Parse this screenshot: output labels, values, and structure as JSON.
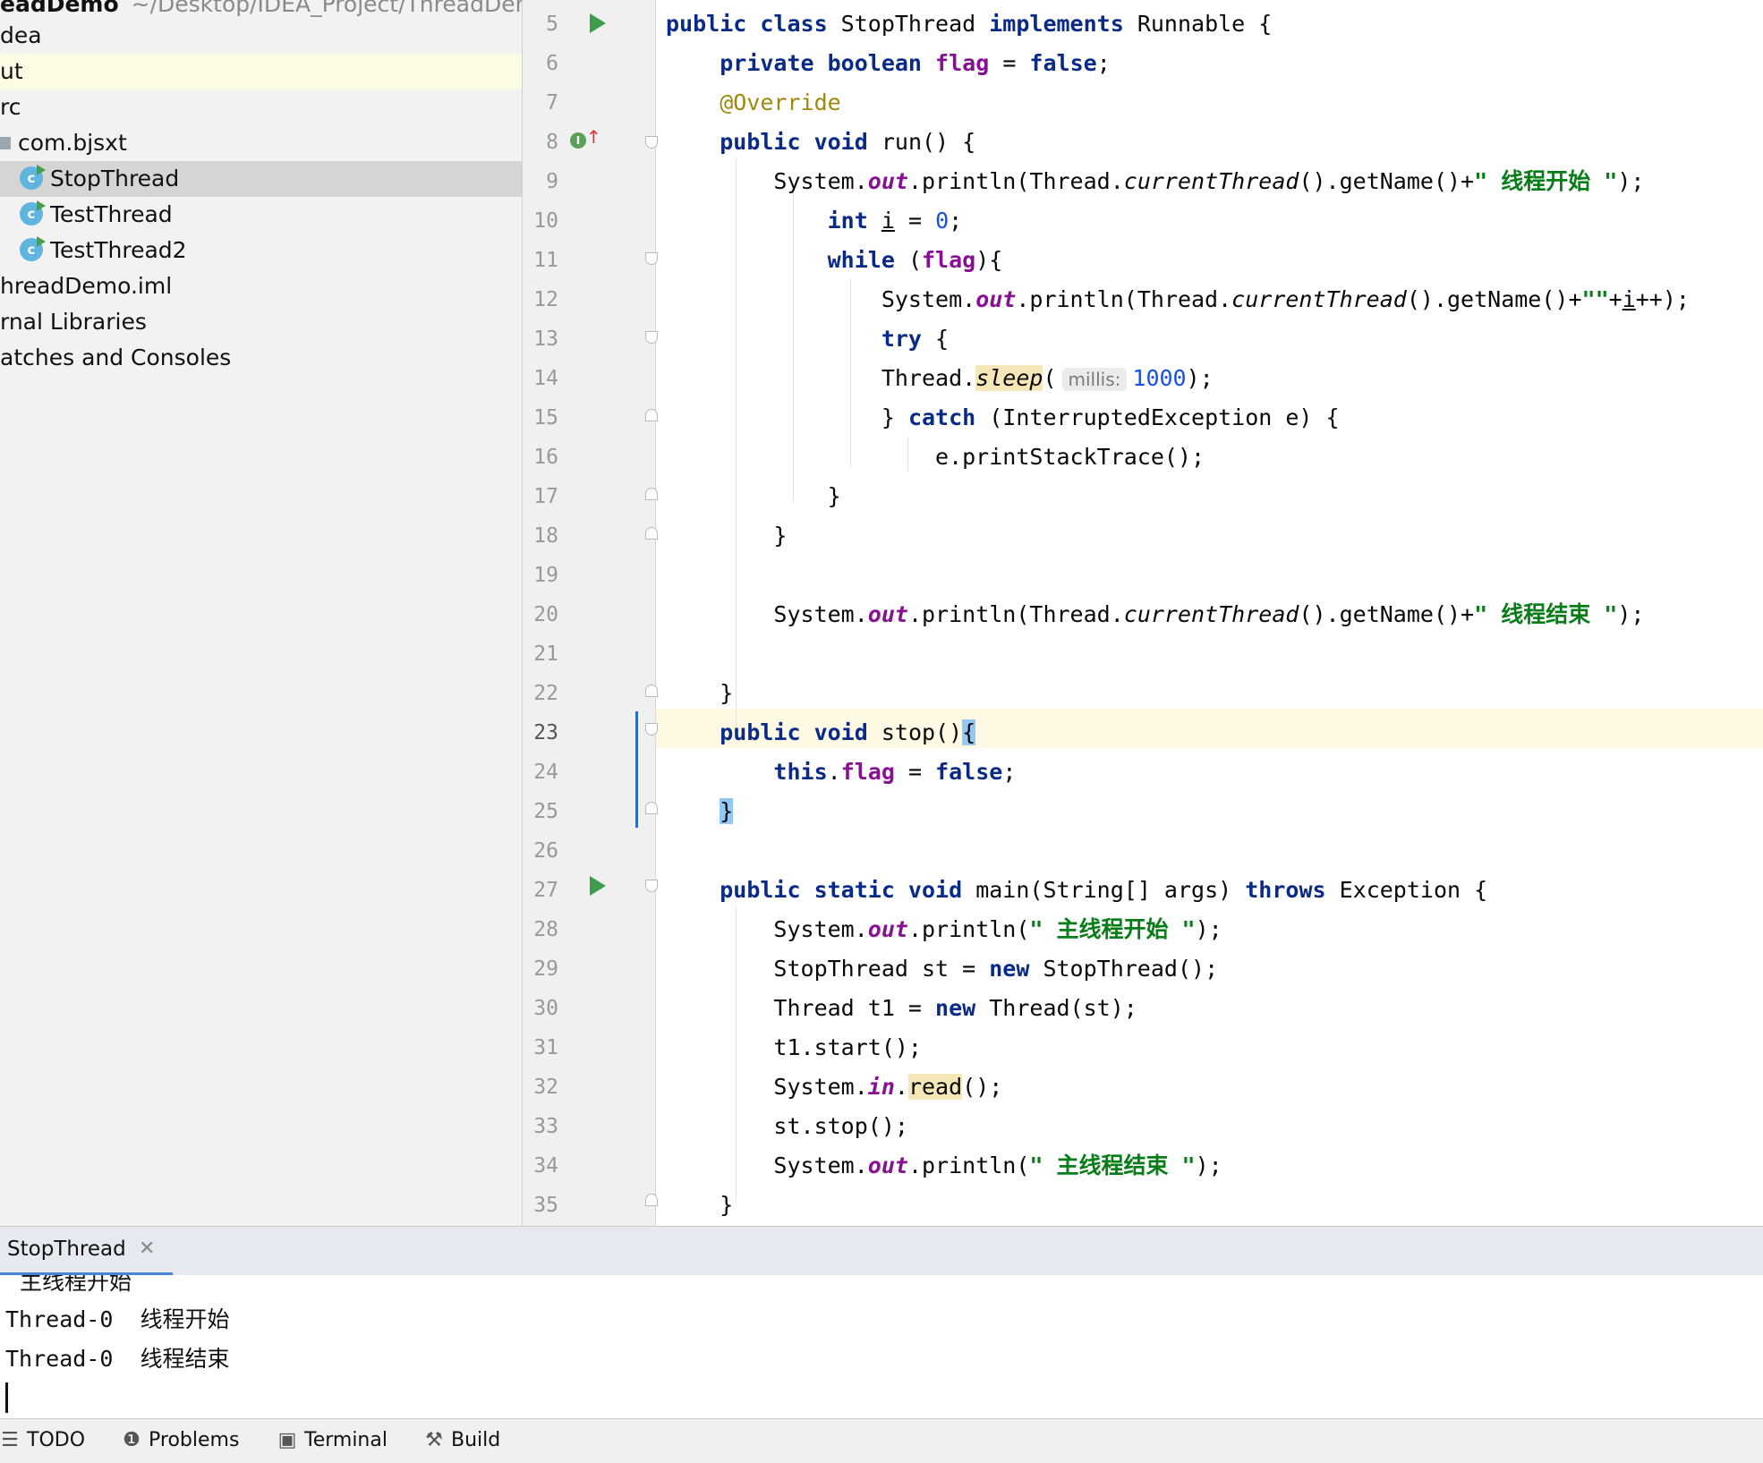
{
  "project": {
    "root_name": "eadDemo",
    "root_path": "~/Desktop/IDEA_Project/ThreadDen",
    "items": [
      {
        "label": "dea"
      },
      {
        "label": "ut"
      },
      {
        "label": "rc"
      },
      {
        "label": "com.bjsxt"
      },
      {
        "label": "StopThread"
      },
      {
        "label": "TestThread"
      },
      {
        "label": "TestThread2"
      },
      {
        "label": "hreadDemo.iml"
      },
      {
        "label": "rnal Libraries"
      },
      {
        "label": "atches and Consoles"
      }
    ]
  },
  "editor": {
    "line_numbers": [
      "5",
      "6",
      "7",
      "8",
      "9",
      "10",
      "11",
      "12",
      "13",
      "14",
      "15",
      "16",
      "17",
      "18",
      "19",
      "20",
      "21",
      "22",
      "23",
      "24",
      "25",
      "26",
      "27",
      "28",
      "29",
      "30",
      "31",
      "32",
      "33",
      "34",
      "35"
    ],
    "lines": [
      {
        "parts": [
          {
            "t": "public class ",
            "c": "k"
          },
          {
            "t": "StopThread "
          },
          {
            "t": "implements ",
            "c": "k"
          },
          {
            "t": "Runnable {"
          }
        ]
      },
      {
        "parts": [
          {
            "t": "    "
          },
          {
            "t": "private boolean ",
            "c": "k"
          },
          {
            "t": "flag",
            "c": "fld"
          },
          {
            "t": " = "
          },
          {
            "t": "false",
            "c": "k"
          },
          {
            "t": ";"
          }
        ]
      },
      {
        "parts": [
          {
            "t": "    "
          },
          {
            "t": "@Override",
            "c": "an"
          }
        ]
      },
      {
        "parts": [
          {
            "t": "    "
          },
          {
            "t": "public void ",
            "c": "k"
          },
          {
            "t": "run() {"
          }
        ]
      },
      {
        "parts": [
          {
            "t": "        System."
          },
          {
            "t": "out",
            "c": "fi"
          },
          {
            "t": ".println(Thread."
          },
          {
            "t": "currentThread",
            "c": "it"
          },
          {
            "t": "().getName()+"
          },
          {
            "t": "\" 线程开始 \"",
            "c": "s"
          },
          {
            "t": ");"
          }
        ]
      },
      {
        "parts": [
          {
            "t": "            "
          },
          {
            "t": "int ",
            "c": "k"
          },
          {
            "t": "i",
            "c": "ul"
          },
          {
            "t": " = "
          },
          {
            "t": "0",
            "c": "n"
          },
          {
            "t": ";"
          }
        ]
      },
      {
        "parts": [
          {
            "t": "            "
          },
          {
            "t": "while ",
            "c": "k"
          },
          {
            "t": "("
          },
          {
            "t": "flag",
            "c": "fld"
          },
          {
            "t": "){"
          }
        ]
      },
      {
        "parts": [
          {
            "t": "                System."
          },
          {
            "t": "out",
            "c": "fi"
          },
          {
            "t": ".println(Thread."
          },
          {
            "t": "currentThread",
            "c": "it"
          },
          {
            "t": "().getName()+"
          },
          {
            "t": "\"\"",
            "c": "s"
          },
          {
            "t": "+"
          },
          {
            "t": "i",
            "c": "ul"
          },
          {
            "t": "++);"
          }
        ]
      },
      {
        "parts": [
          {
            "t": "                "
          },
          {
            "t": "try ",
            "c": "k"
          },
          {
            "t": "{"
          }
        ]
      },
      {
        "parts": [
          {
            "t": "                Thread."
          },
          {
            "t": "sleep",
            "c": "it usage"
          },
          {
            "t": "("
          },
          {
            "t": "millis:",
            "c": "hint"
          },
          {
            "t": "1000",
            "c": "n"
          },
          {
            "t": ");"
          }
        ]
      },
      {
        "parts": [
          {
            "t": "                } "
          },
          {
            "t": "catch ",
            "c": "k"
          },
          {
            "t": "(InterruptedException e) {"
          }
        ]
      },
      {
        "parts": [
          {
            "t": "                    e.printStackTrace();"
          }
        ]
      },
      {
        "parts": [
          {
            "t": "            }"
          }
        ]
      },
      {
        "parts": [
          {
            "t": "        }"
          }
        ]
      },
      {
        "parts": [
          {
            "t": ""
          }
        ]
      },
      {
        "parts": [
          {
            "t": "        System."
          },
          {
            "t": "out",
            "c": "fi"
          },
          {
            "t": ".println(Thread."
          },
          {
            "t": "currentThread",
            "c": "it"
          },
          {
            "t": "().getName()+"
          },
          {
            "t": "\" 线程结束 \"",
            "c": "s"
          },
          {
            "t": ");"
          }
        ]
      },
      {
        "parts": [
          {
            "t": ""
          }
        ]
      },
      {
        "parts": [
          {
            "t": "    }"
          }
        ]
      },
      {
        "parts": [
          {
            "t": "    "
          },
          {
            "t": "public void ",
            "c": "k"
          },
          {
            "t": "stop()"
          },
          {
            "t": "{",
            "c": "match"
          }
        ]
      },
      {
        "parts": [
          {
            "t": "        "
          },
          {
            "t": "this",
            "c": "k"
          },
          {
            "t": "."
          },
          {
            "t": "flag",
            "c": "fld"
          },
          {
            "t": " = "
          },
          {
            "t": "false",
            "c": "k"
          },
          {
            "t": ";"
          }
        ]
      },
      {
        "parts": [
          {
            "t": "    "
          },
          {
            "t": "}",
            "c": "match"
          }
        ]
      },
      {
        "parts": [
          {
            "t": ""
          }
        ]
      },
      {
        "parts": [
          {
            "t": "    "
          },
          {
            "t": "public static void ",
            "c": "k"
          },
          {
            "t": "main(String[] args) "
          },
          {
            "t": "throws ",
            "c": "k"
          },
          {
            "t": "Exception {"
          }
        ]
      },
      {
        "parts": [
          {
            "t": "        System."
          },
          {
            "t": "out",
            "c": "fi"
          },
          {
            "t": ".println("
          },
          {
            "t": "\" 主线程开始 \"",
            "c": "s"
          },
          {
            "t": ");"
          }
        ]
      },
      {
        "parts": [
          {
            "t": "        StopThread st = "
          },
          {
            "t": "new ",
            "c": "k"
          },
          {
            "t": "StopThread();"
          }
        ]
      },
      {
        "parts": [
          {
            "t": "        Thread t1 = "
          },
          {
            "t": "new ",
            "c": "k"
          },
          {
            "t": "Thread(st);"
          }
        ]
      },
      {
        "parts": [
          {
            "t": "        t1.start();"
          }
        ]
      },
      {
        "parts": [
          {
            "t": "        System."
          },
          {
            "t": "in",
            "c": "fi"
          },
          {
            "t": "."
          },
          {
            "t": "read",
            "c": "usage"
          },
          {
            "t": "();"
          }
        ]
      },
      {
        "parts": [
          {
            "t": "        st.stop();"
          }
        ]
      },
      {
        "parts": [
          {
            "t": "        System."
          },
          {
            "t": "out",
            "c": "fi"
          },
          {
            "t": ".println("
          },
          {
            "t": "\" 主线程结束 \"",
            "c": "s"
          },
          {
            "t": ");"
          }
        ]
      },
      {
        "parts": [
          {
            "t": "    }"
          }
        ]
      }
    ]
  },
  "run": {
    "tab_label": "StopThread",
    "close_glyph": "✕",
    "output": [
      "主线程开始",
      "Thread-0  线程开始",
      "Thread-0  线程结束"
    ]
  },
  "toolbar": {
    "items": [
      {
        "label": "TODO",
        "icon": "list-icon",
        "glyph": "☰"
      },
      {
        "label": "Problems",
        "icon": "warning-icon",
        "glyph": "❶"
      },
      {
        "label": "Terminal",
        "icon": "terminal-icon",
        "glyph": "▣"
      },
      {
        "label": "Build",
        "icon": "hammer-icon",
        "glyph": "⚒"
      }
    ]
  },
  "colors": {
    "keyword": "#0a2a87",
    "string": "#067d17",
    "number": "#1750eb",
    "annotation": "#9e880d",
    "field": "#871094",
    "current_line": "#fdf9e3",
    "selection": "#d5d5d5"
  }
}
